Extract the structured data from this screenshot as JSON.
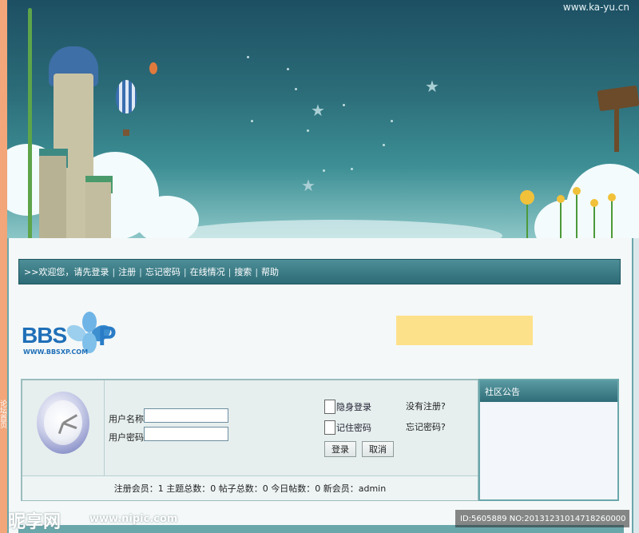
{
  "banner": {
    "site_url": "www.ka-yu.cn"
  },
  "left_strip": {
    "vertical_text": "论坛首页"
  },
  "nav": {
    "prefix": ">>",
    "items": [
      "欢迎您，请先登录",
      "注册",
      "忘记密码",
      "在线情况",
      "搜索",
      "帮助"
    ],
    "separator": "|"
  },
  "logo": {
    "text": "BBS",
    "suffix": "P",
    "url": "WWW.BBSXP.COM"
  },
  "login": {
    "username_label": "用户名称:",
    "password_label": "用户密码:",
    "username_value": "",
    "password_value": "",
    "hide_login_label": "隐身登录",
    "remember_password_label": "记住密码",
    "login_button": "登录",
    "cancel_button": "取消",
    "no_register_link": "没有注册?",
    "forgot_password_link": "忘记密码?"
  },
  "stats": "注册会员：1 主题总数：0 帖子总数：0 今日帖数：0 新会员：admin",
  "notice": {
    "title": "社区公告"
  },
  "watermark": {
    "site_logo": "昵享网",
    "site_url": "www.nipic.com",
    "id_text": "ID:5605889 NO:20131231014718260000"
  },
  "colors": {
    "nav_bg": "#2d6b76",
    "ad_banner": "#fde18a",
    "left_strip": "#f2a679"
  }
}
